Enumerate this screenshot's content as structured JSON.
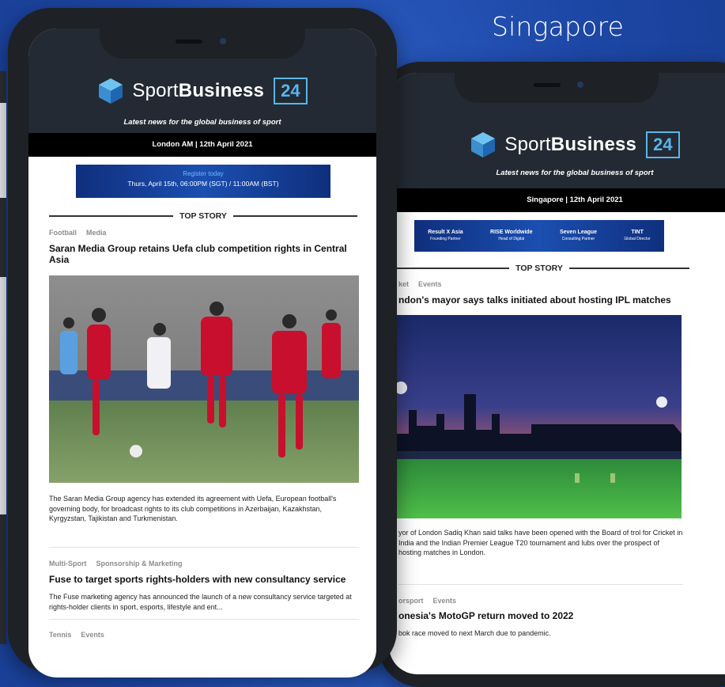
{
  "region_label": "Singapore",
  "front_newsletter": {
    "brand_plain": "Sport",
    "brand_bold": "Business",
    "badge": "24",
    "tagline": "Latest news for the global business of sport",
    "dateline": "London AM | 12th April 2021",
    "banner": {
      "line1": "Register today",
      "line2": "Thurs, April 15th, 06:00PM (SGT) / 11:00AM (BST)"
    },
    "section_title": "TOP STORY",
    "top_story": {
      "tags": [
        "Football",
        "Media"
      ],
      "headline": "Saran Media Group retains Uefa club competition rights in Central Asia",
      "body": "The Saran Media Group agency has extended its agreement with Uefa, European football's governing body, for broadcast rights to its club competitions in Azerbaijan, Kazakhstan, Kyrgyzstan, Tajikistan and Turkmenistan."
    },
    "story2": {
      "tags": [
        "Multi-Sport",
        "Sponsorship & Marketing"
      ],
      "headline": "Fuse to target sports rights-holders with new consultancy service",
      "body": "The Fuse marketing agency has announced the launch of a new consultancy service targeted at rights-holder clients in sport, esports, lifestyle and ent..."
    },
    "story3": {
      "tags": [
        "Tennis",
        "Events"
      ]
    }
  },
  "back_newsletter": {
    "brand_plain": "Sport",
    "brand_bold": "Business",
    "badge": "24",
    "tagline": "Latest news for the global business of sport",
    "dateline": "Singapore | 12th April 2021",
    "banner_people": [
      {
        "name": "Result X Asia",
        "role": "Founding Partner"
      },
      {
        "name": "RISE Worldwide",
        "role": "Head of Digital"
      },
      {
        "name": "Seven League",
        "role": "Consulting Partner"
      },
      {
        "name": "TINT",
        "role": "Global Director"
      }
    ],
    "section_title": "TOP STORY",
    "top_story": {
      "tags": [
        "ket",
        "Events"
      ],
      "headline": "ndon's mayor says talks initiated about hosting IPL matches",
      "body": "yor of London Sadiq Khan said talks have been opened with the Board of trol for Cricket in India and the Indian Premier League T20 tournament and lubs over the prospect of hosting matches in London."
    },
    "story2": {
      "tags": [
        "orsport",
        "Events"
      ],
      "headline": "onesia's MotoGP return moved to 2022",
      "body": "bok race moved to next March due to pandemic."
    }
  },
  "colors": {
    "background": "#1d47a6",
    "header": "#232a33",
    "accent": "#58b6ea",
    "phone_frame": "#1e2125"
  }
}
